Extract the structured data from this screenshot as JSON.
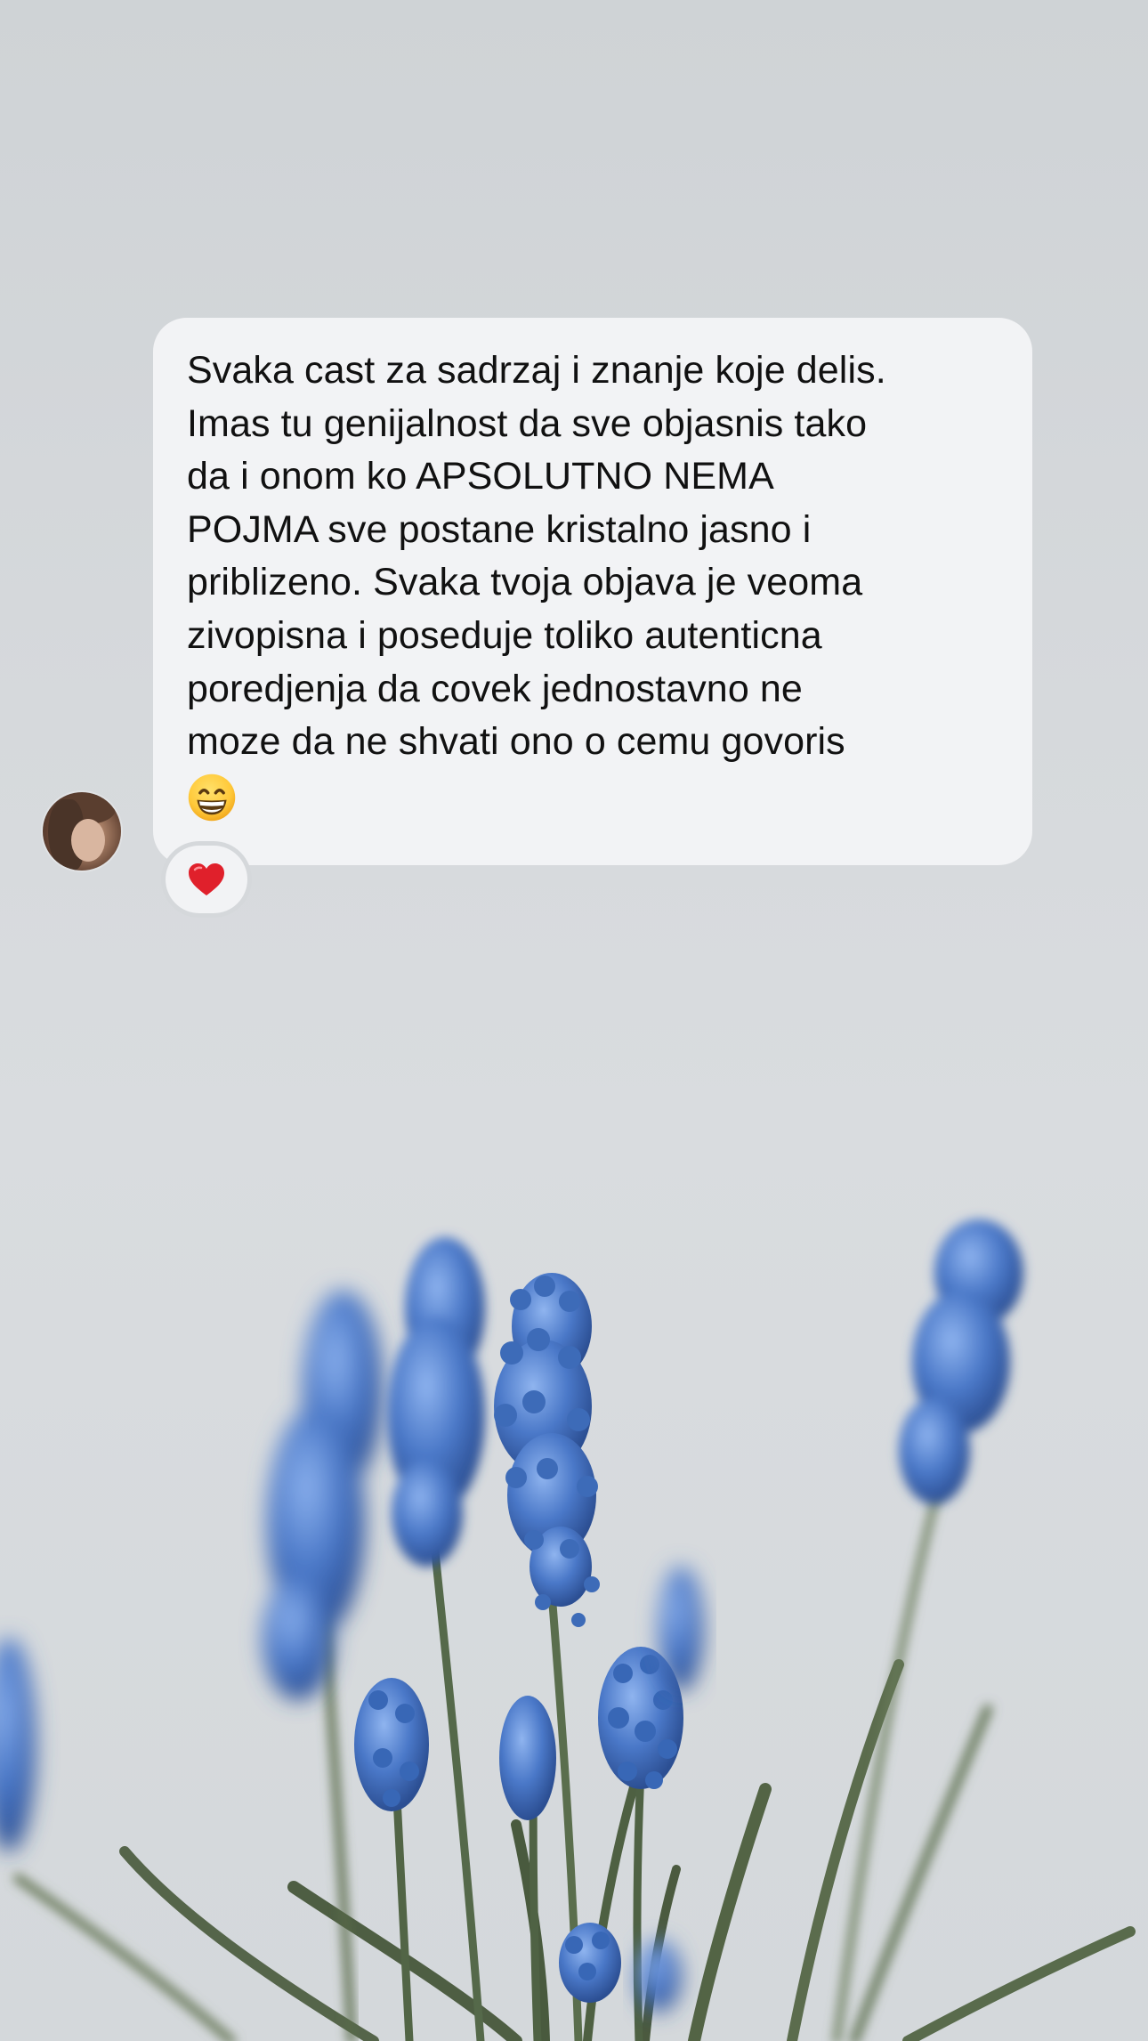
{
  "message": {
    "text": "Svaka cast za sadrzaj i znanje koje delis.\nImas tu genijalnost da sve objasnis tako\nda i onom ko APSOLUTNO NEMA\nPOJMA sve postane kristalno jasno i\npriblizeno. Svaka tvoja objava je veoma\nzivopisna i poseduje toliko autenticna\nporedjenja da covek jednostavno ne\nmoze da ne shvati ono o cemu govoris",
    "trailing_emoji": "grinning-face-with-smiling-eyes-icon"
  },
  "reaction": {
    "icon": "red-heart-icon",
    "color": "#e0202b"
  },
  "sender": {
    "avatar": "profile-photo"
  },
  "colors": {
    "bubble": "#f2f3f5",
    "background": "#d6d9dc",
    "flowers": "#4a78c8",
    "stems": "#5d6f4e"
  }
}
